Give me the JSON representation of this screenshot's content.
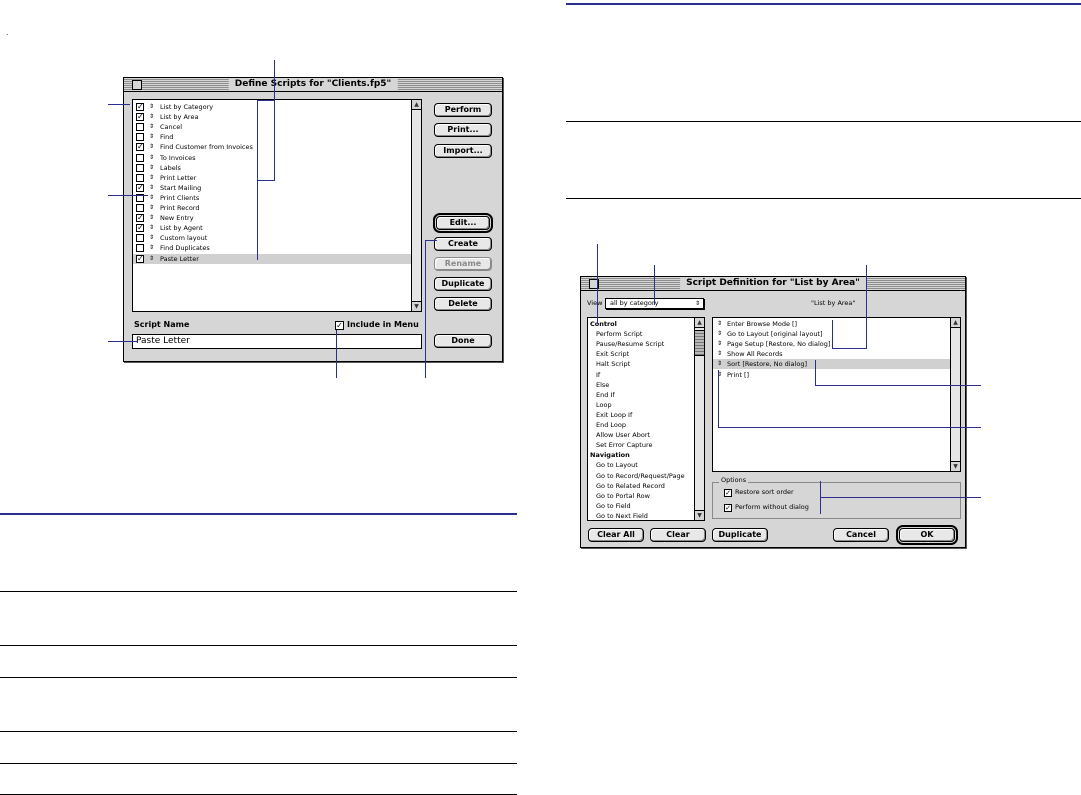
{
  "left_dialog": {
    "title": "Define Scripts for \"Clients.fp5\"",
    "scripts": [
      {
        "name": "List by Category",
        "checked": true
      },
      {
        "name": "List by Area",
        "checked": true
      },
      {
        "name": "Cancel",
        "checked": false
      },
      {
        "name": "Find",
        "checked": false
      },
      {
        "name": "Find Customer from Invoices",
        "checked": true
      },
      {
        "name": "To Invoices",
        "checked": false
      },
      {
        "name": "Labels",
        "checked": false
      },
      {
        "name": "Print Letter",
        "checked": false
      },
      {
        "name": "Start Mailing",
        "checked": true
      },
      {
        "name": "Print Clients",
        "checked": false
      },
      {
        "name": "Print Record",
        "checked": false
      },
      {
        "name": "New Entry",
        "checked": true
      },
      {
        "name": "List by Agent",
        "checked": true
      },
      {
        "name": "Custom layout",
        "checked": false
      },
      {
        "name": "Find Duplicates",
        "checked": false
      },
      {
        "name": "Paste Letter",
        "checked": true,
        "selected": true
      }
    ],
    "buttons": {
      "perform": "Perform",
      "print": "Print...",
      "import": "Import...",
      "edit": "Edit...",
      "create": "Create",
      "rename": "Rename",
      "duplicate": "Duplicate",
      "delete": "Delete",
      "done": "Done"
    },
    "script_name_label": "Script Name",
    "script_name_value": "Paste Letter",
    "include_in_menu_label": "Include in Menu",
    "include_in_menu_checked": true
  },
  "right_dialog": {
    "title": "Script Definition for \"List by Area\"",
    "view_label": "View",
    "view_value": "all by category",
    "script_caption": "\"List by Area\"",
    "categories": [
      {
        "label": "Control",
        "header": true
      },
      {
        "label": "Perform Script"
      },
      {
        "label": "Pause/Resume Script"
      },
      {
        "label": "Exit Script"
      },
      {
        "label": "Halt Script"
      },
      {
        "label": "If"
      },
      {
        "label": "Else"
      },
      {
        "label": "End If"
      },
      {
        "label": "Loop"
      },
      {
        "label": "Exit Loop If"
      },
      {
        "label": "End Loop"
      },
      {
        "label": "Allow User Abort"
      },
      {
        "label": "Set Error Capture"
      },
      {
        "label": "Navigation",
        "header": true
      },
      {
        "label": "Go to Layout"
      },
      {
        "label": "Go to Record/Request/Page"
      },
      {
        "label": "Go to Related Record"
      },
      {
        "label": "Go to Portal Row"
      },
      {
        "label": "Go to Field"
      },
      {
        "label": "Go to Next Field"
      }
    ],
    "steps": [
      {
        "label": "Enter Browse Mode []"
      },
      {
        "label": "Go to Layout [original layout]"
      },
      {
        "label": "Page Setup [Restore, No dialog]"
      },
      {
        "label": "Show All Records"
      },
      {
        "label": "Sort [Restore, No dialog]",
        "selected": true
      },
      {
        "label": "Print []"
      }
    ],
    "options_label": "Options",
    "restore_sort_order": "Restore sort order",
    "perform_without_dialog": "Perform without dialog",
    "buttons": {
      "clear_all": "Clear All",
      "clear": "Clear",
      "duplicate": "Duplicate",
      "cancel": "Cancel",
      "ok": "OK"
    }
  },
  "page_mark": "."
}
